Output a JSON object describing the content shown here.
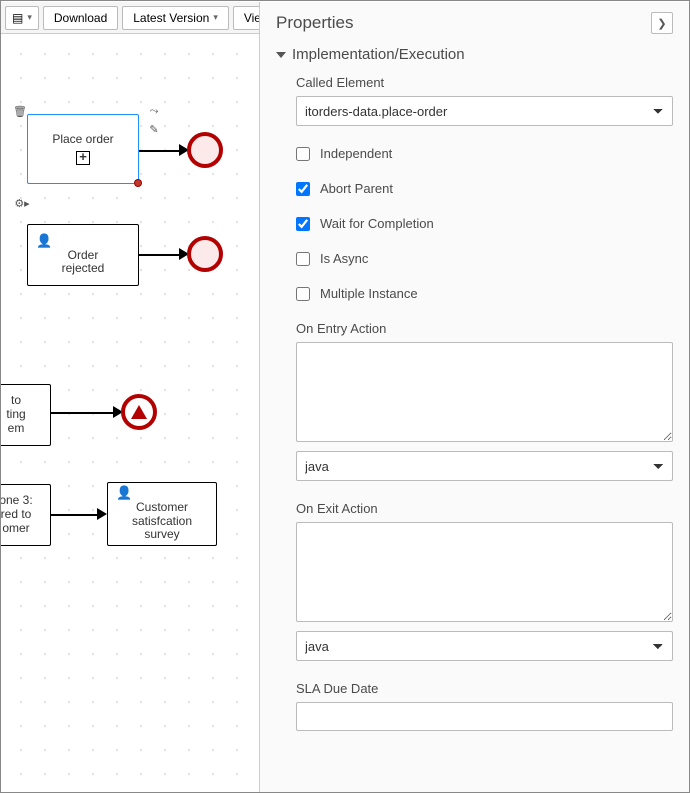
{
  "toolbar": {
    "icon_dropdown_label": "",
    "download_label": "Download",
    "latest_version_label": "Latest Version",
    "view_alerts_label": "View A"
  },
  "panel": {
    "title": "Properties",
    "section_title": "Implementation/Execution",
    "called_element_label": "Called Element",
    "called_element_value": "itorders-data.place-order",
    "independent_label": "Independent",
    "independent_checked": false,
    "abort_parent_label": "Abort Parent",
    "abort_parent_checked": true,
    "wait_label": "Wait for Completion",
    "wait_checked": true,
    "is_async_label": "Is Async",
    "is_async_checked": false,
    "multiple_instance_label": "Multiple Instance",
    "multiple_instance_checked": false,
    "on_entry_label": "On Entry Action",
    "on_entry_value": "",
    "on_entry_lang": "java",
    "on_exit_label": "On Exit Action",
    "on_exit_value": "",
    "on_exit_lang": "java",
    "sla_label": "SLA Due Date",
    "sla_value": ""
  },
  "canvas": {
    "nodes": {
      "place_order": "Place order",
      "order_rejected": "Order\nrejected",
      "send_to": "to\nting\nem",
      "milestone3": "one 3:\nred to\nomer",
      "customer_survey": "Customer\nsatisfcation\nsurvey"
    }
  }
}
